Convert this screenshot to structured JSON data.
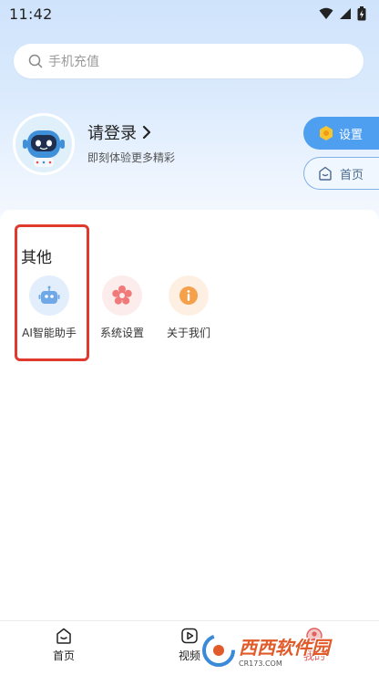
{
  "status_bar": {
    "time": "11:42"
  },
  "search": {
    "placeholder": "手机充值"
  },
  "profile": {
    "login_title": "请登录",
    "login_subtitle": "即刻体验更多精彩"
  },
  "side_buttons": {
    "settings_label": "设置",
    "home_label": "首页"
  },
  "section": {
    "title": "其他",
    "items": [
      {
        "label": "AI智能助手",
        "icon": "robot-icon",
        "color": "#6fa8e8"
      },
      {
        "label": "系统设置",
        "icon": "flower-gear-icon",
        "color": "#f07a7a"
      },
      {
        "label": "关于我们",
        "icon": "info-icon",
        "color": "#f5a04b"
      }
    ]
  },
  "bottom_nav": {
    "items": [
      {
        "label": "首页",
        "icon": "home-icon"
      },
      {
        "label": "视频",
        "icon": "video-icon"
      },
      {
        "label": "我的",
        "icon": "profile-icon"
      }
    ]
  },
  "watermark": {
    "brand": "西西软件园",
    "url": "CR173.COM"
  },
  "colors": {
    "accent": "#4f9ff0",
    "highlight": "#e03a2e"
  }
}
